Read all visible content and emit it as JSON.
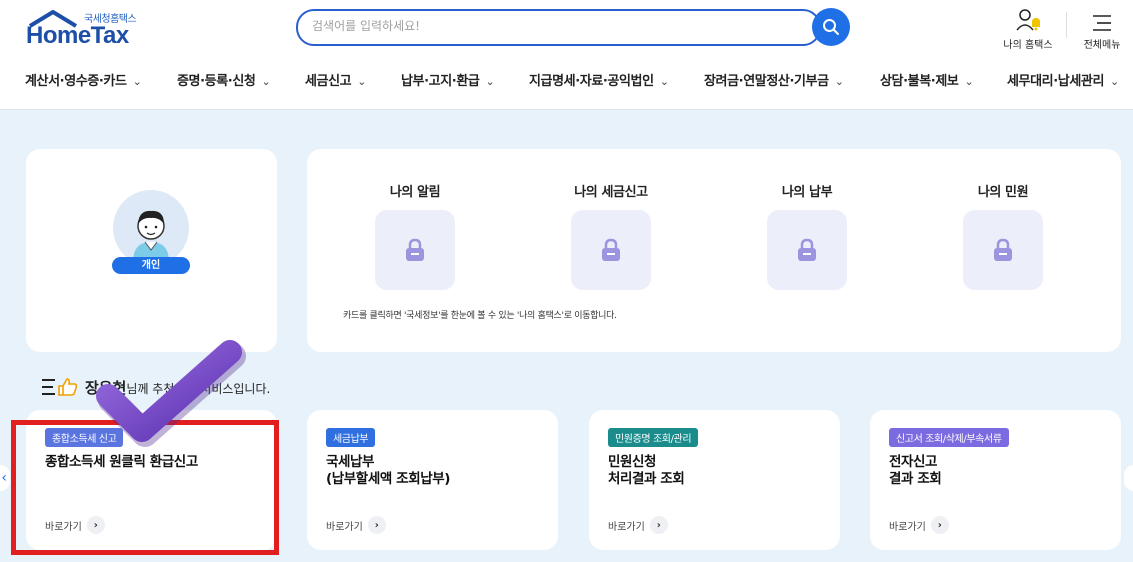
{
  "logo": {
    "sub": "국세청홈택스",
    "main": "HomeTax"
  },
  "search": {
    "placeholder": "검색어를 입력하세요!"
  },
  "utils": {
    "my_hometax": "나의 홈택스",
    "all_menu": "전체메뉴"
  },
  "gnb": [
    {
      "label": "계산서·영수증·카드"
    },
    {
      "label": "증명·등록·신청"
    },
    {
      "label": "세금신고"
    },
    {
      "label": "납부·고지·환급"
    },
    {
      "label": "지급명세·자료·공익법인"
    },
    {
      "label": "장려금·연말정산·기부금"
    },
    {
      "label": "상담·불복·제보"
    },
    {
      "label": "세무대리·납세관리"
    }
  ],
  "profile": {
    "badge": "개인"
  },
  "my": {
    "items": [
      {
        "title": "나의 알림",
        "icon": "lock-icon"
      },
      {
        "title": "나의 세금신고",
        "icon": "lock-icon"
      },
      {
        "title": "나의 납부",
        "icon": "lock-icon"
      },
      {
        "title": "나의 민원",
        "icon": "lock-icon"
      }
    ],
    "note": "카드를 클릭하면 '국세정보'를 한눈에 볼 수 있는 '나의 홈택스'로 이동합니다."
  },
  "recommend": {
    "name": "장유현",
    "text": "님께 추천하는 서비스입니다."
  },
  "services": [
    {
      "tag": "종합소득세 신고",
      "tag_color": "#5a74e0",
      "title": "종합소득세 원클릭 환급신고",
      "go": "바로가기"
    },
    {
      "tag": "세금납부",
      "tag_color": "#2f6fe0",
      "title": "국세납부\n(납부할세액 조회납부)",
      "go": "바로가기"
    },
    {
      "tag": "민원증명 조회/관리",
      "tag_color": "#1b8c8c",
      "title": "민원신청\n처리결과 조회",
      "go": "바로가기"
    },
    {
      "tag": "신고서 조회/삭제/부속서류",
      "tag_color": "#7b6be0",
      "title": "전자신고\n결과 조회",
      "go": "바로가기"
    }
  ],
  "colors": {
    "accent": "#1f6fe6",
    "highlight": "#e11f1f",
    "check": "#6a3fc2"
  }
}
